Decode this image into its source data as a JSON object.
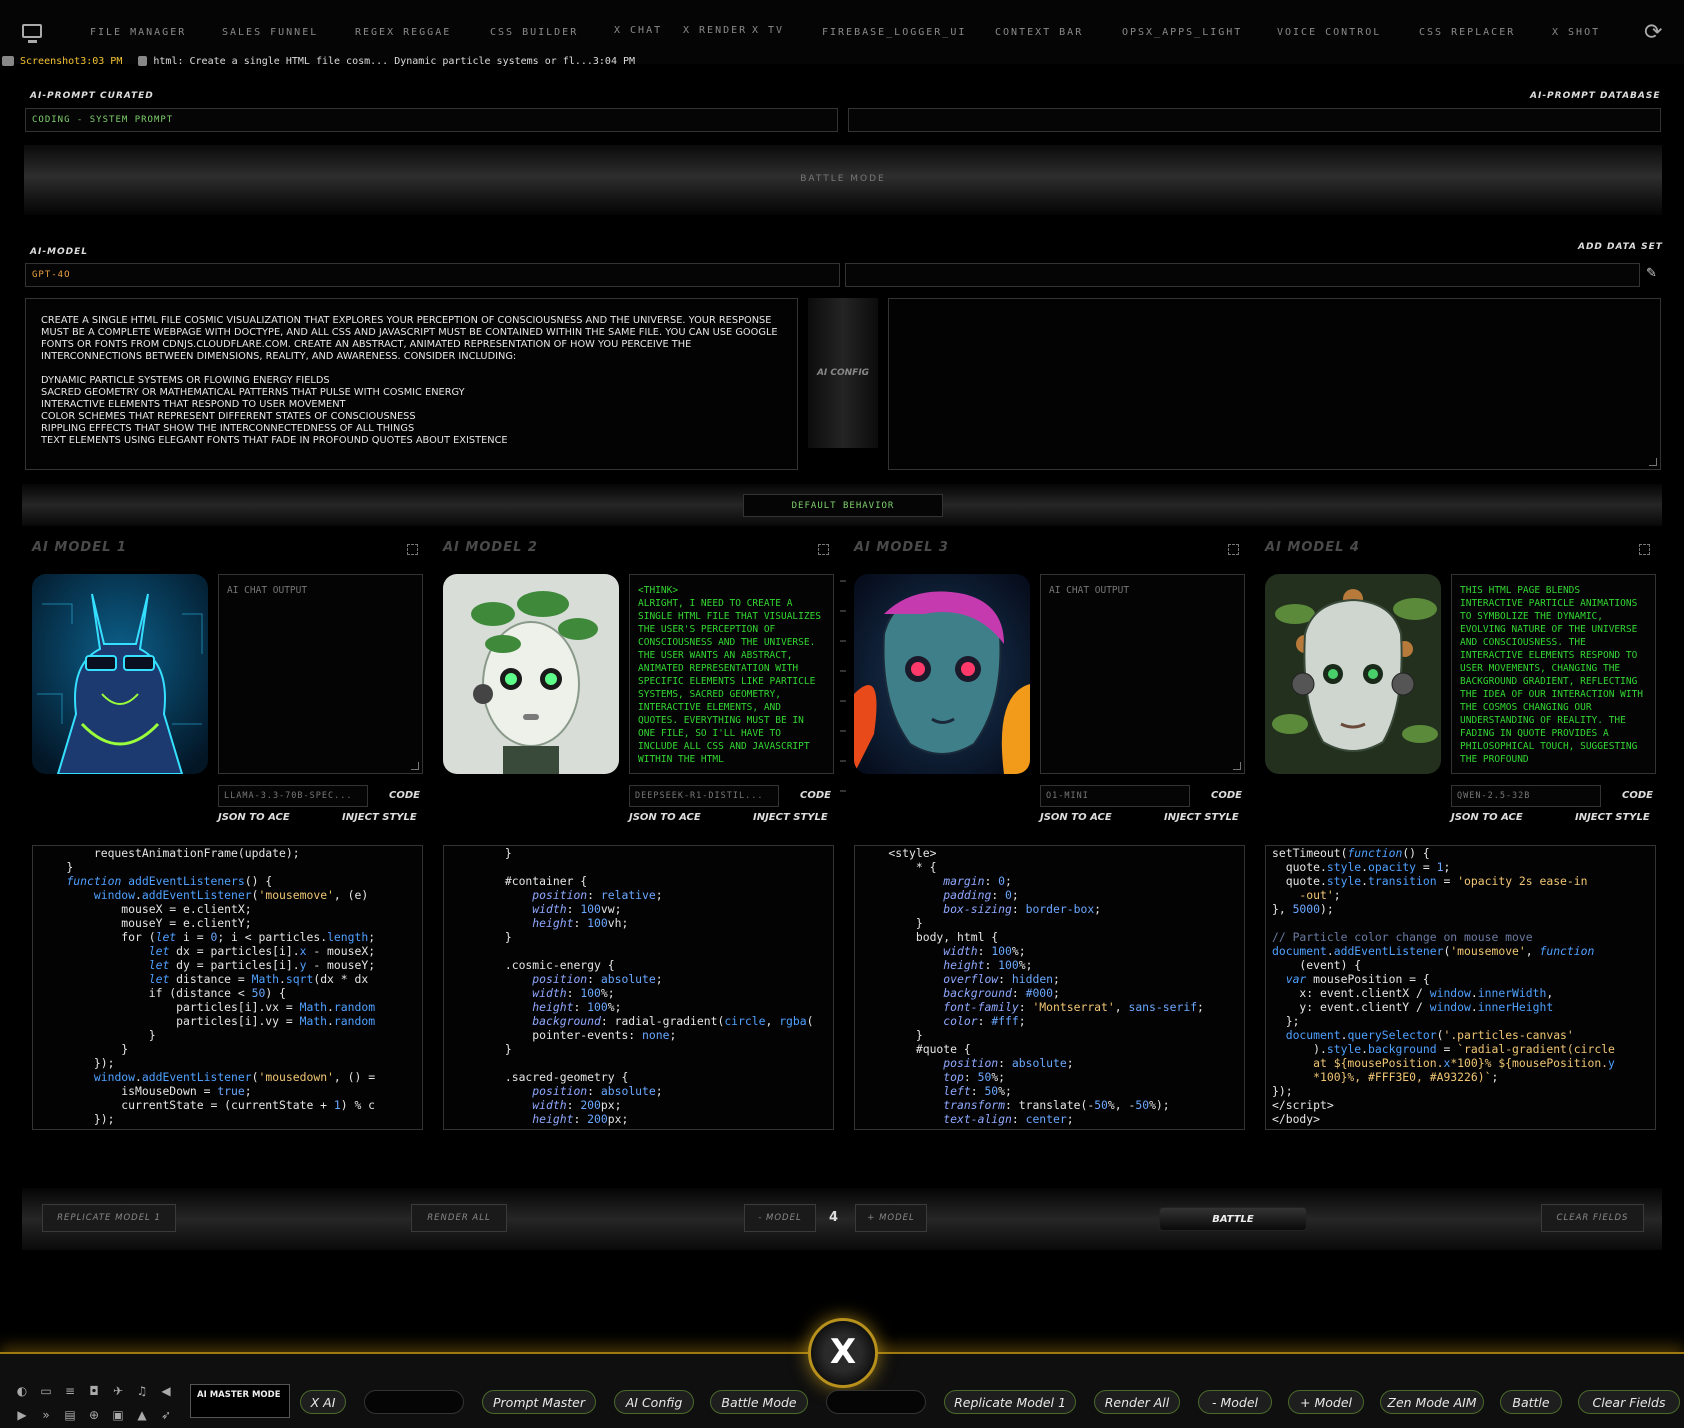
{
  "nav": {
    "items": [
      "FILE MANAGER",
      "SALES FUNNEL",
      "REGEX REGGAE",
      "CSS BUILDER",
      "X CHAT",
      "X RENDER",
      "X TV",
      "FIREBASE_LOGGER_UI",
      "CONTEXT BAR",
      "OPSX_APPS_LIGHT",
      "VOICE CONTROL",
      "CSS REPLACER",
      "X SHOT"
    ]
  },
  "status": {
    "screenshot": "Screenshot3:03 PM",
    "file": "html: Create a single HTML file cosm... Dynamic particle systems or fl...3:04 PM"
  },
  "prompt": {
    "curated_label": "AI-PROMPT CURATED",
    "curated_value": "CODING - SYSTEM PROMPT",
    "database_label": "AI-PROMPT DATABASE",
    "database_value": "",
    "battle_mode": "BATTLE MODE"
  },
  "model_cfg": {
    "label": "AI-MODEL",
    "value": "GPT-4O",
    "dataset_label": "ADD DATA SET",
    "dataset_value": ""
  },
  "prompt_text": "Create a single HTML file cosmic visualization that explores your perception of consciousness and the universe. Your response must be a complete webpage with DOCTYPE, and all CSS and JavaScript must be contained within the same file. You can use Google Fonts or fonts from cdnjs.cloudflare.com. Create an abstract, animated representation of how you perceive the interconnections between dimensions, reality, and awareness. Consider including:\n\nDynamic particle systems or flowing energy fields\nSacred geometry or mathematical patterns that pulse with cosmic energy\nInteractive elements that respond to user movement\nColor schemes that represent different states of consciousness\nRippling effects that show the interconnectedness of all things\nText elements using elegant fonts that fade in profound quotes about existence",
  "ai_config_label": "AI CONFIG",
  "default_behavior": "DEFAULT BEHAVIOR",
  "models": [
    {
      "title": "AI MODEL 1",
      "chat": "",
      "chat_placeholder": "AI CHAT OUTPUT",
      "model_name": "LLAMA-3.3-70B-SPEC...",
      "code_label": "CODE",
      "json_label": "JSON TO ACE",
      "inject_label": "INJECT STYLE"
    },
    {
      "title": "AI MODEL 2",
      "chat": "<think>\nAlright, I need to create a single HTML file that visualizes the user's perception of consciousness and the universe. The user wants an abstract, animated representation with specific elements like particle systems, sacred geometry, interactive elements, and quotes. Everything must be in one file, so I'll have to include all CSS and JavaScript within the HTML",
      "chat_placeholder": "AI CHAT OUTPUT",
      "model_name": "DEEPSEEK-R1-DISTIL...",
      "code_label": "CODE",
      "json_label": "JSON TO ACE",
      "inject_label": "INJECT STYLE"
    },
    {
      "title": "AI MODEL 3",
      "chat": "",
      "chat_placeholder": "AI CHAT OUTPUT",
      "model_name": "O1-MINI",
      "code_label": "CODE",
      "json_label": "JSON TO ACE",
      "inject_label": "INJECT STYLE"
    },
    {
      "title": "AI MODEL 4",
      "chat": "This HTML page blends interactive particle animations to symbolize the dynamic, evolving nature of the universe and consciousness. The interactive elements respond to user movements, changing the background gradient, reflecting the idea of our interaction with the cosmos changing our understanding of reality. The fading in quote provides a philosophical touch, suggesting the profound",
      "chat_placeholder": "AI CHAT OUTPUT",
      "model_name": "QWEN-2.5-32B",
      "code_label": "CODE",
      "json_label": "JSON TO ACE",
      "inject_label": "INJECT STYLE"
    }
  ],
  "actions": {
    "replicate": "REPLICATE MODEL 1",
    "render_all": "RENDER ALL",
    "minus_model": "- MODEL",
    "count": "4",
    "plus_model": "+ MODEL",
    "battle": "BATTLE",
    "clear": "CLEAR FIELDS"
  },
  "dock": {
    "logo": "X",
    "master_mode": "AI MASTER MODE",
    "pills": [
      "X AI",
      "Prompt Master",
      "AI Config",
      "Battle Mode",
      "Replicate Model 1",
      "Render All",
      "- Model",
      "+ Model",
      "Zen Mode AIM",
      "Battle",
      "Clear Fields"
    ]
  },
  "colors": {
    "accent_green": "#33d633",
    "accent_orange": "#f0a040",
    "accent_gold": "#b8901c",
    "status_yellow": "#f2c230"
  }
}
